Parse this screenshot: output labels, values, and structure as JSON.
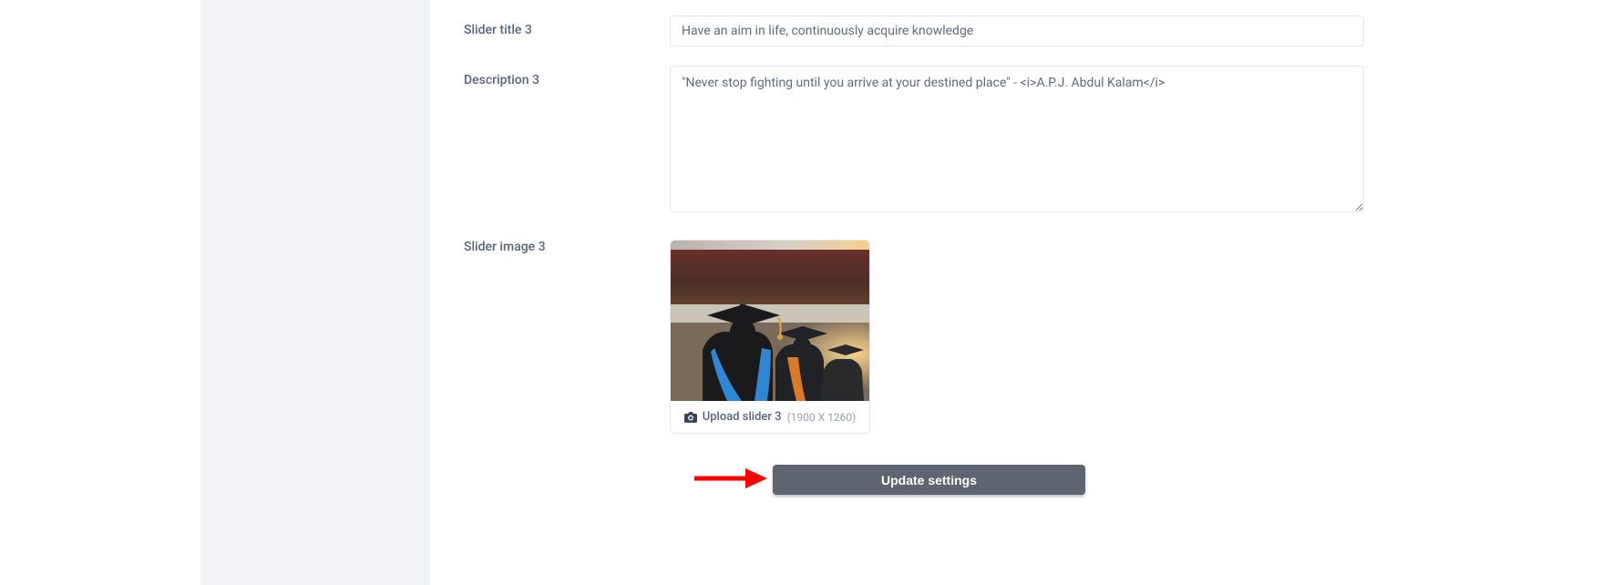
{
  "form": {
    "slider_title_3": {
      "label": "Slider title 3",
      "value": "Have an aim in life, continuously acquire knowledge"
    },
    "description_3": {
      "label": "Description 3",
      "value": "\"Never stop fighting until you arrive at your destined place\" - <i>A.P.J. Abdul Kalam</i>"
    },
    "slider_image_3": {
      "label": "Slider image 3",
      "upload_label": "Upload slider 3",
      "upload_hint": "(1900 X 1260)"
    },
    "submit": {
      "label": "Update settings"
    }
  }
}
